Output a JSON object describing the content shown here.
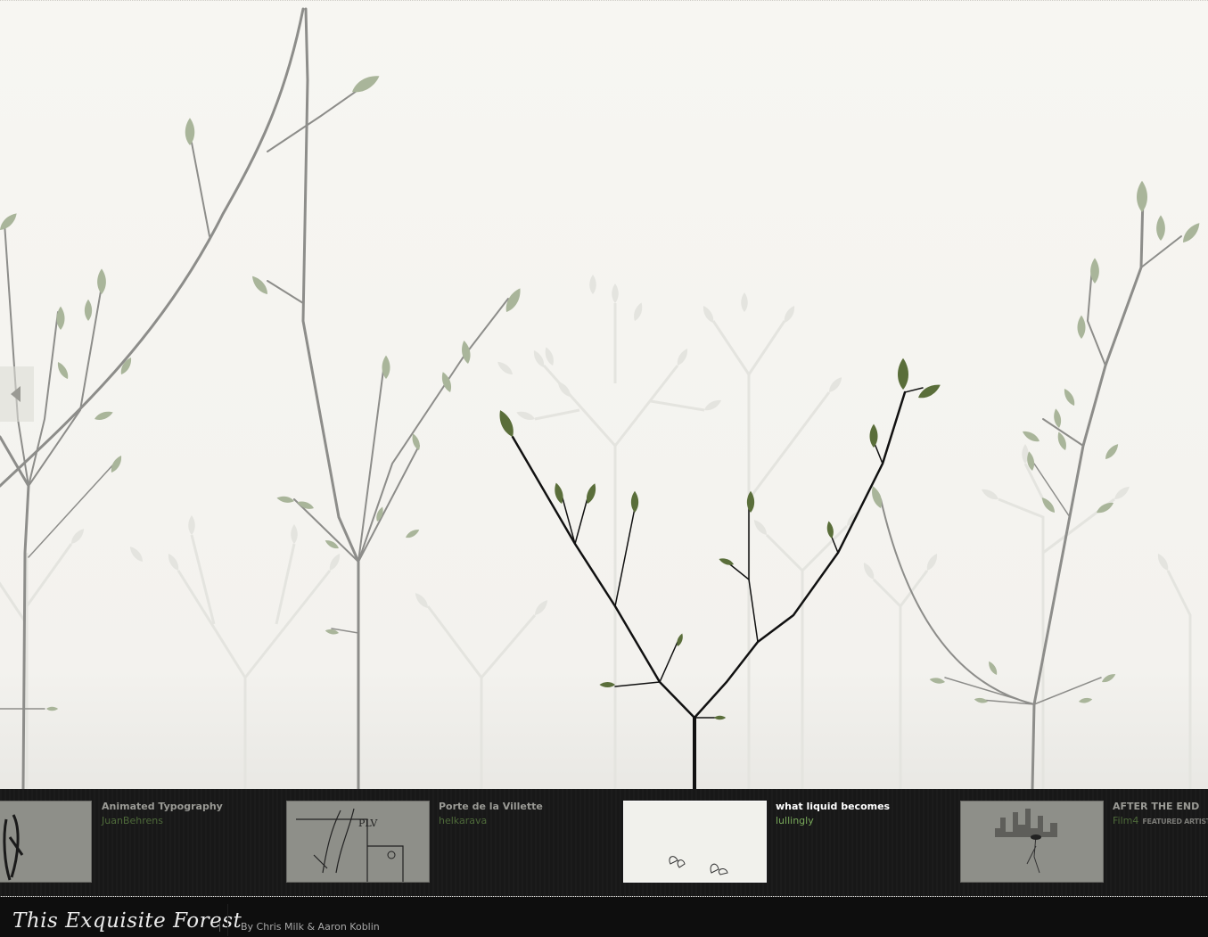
{
  "app": {
    "logo_text": "This Exquisite Forest",
    "credits": "By Chris Milk & Aaron Koblin"
  },
  "nav": {
    "prev_icon": "triangle-left-icon"
  },
  "shelf": {
    "cards": [
      {
        "title": "Animated Typography",
        "author": "JuanBehrens",
        "badge": "",
        "active": false
      },
      {
        "title": "Porte de la Villette",
        "author": "helkarava",
        "badge": "",
        "active": false
      },
      {
        "title": "what liquid becomes",
        "author": "lullingly",
        "badge": "",
        "active": true
      },
      {
        "title": "AFTER THE END",
        "author": "Film4",
        "badge": "FEATURED ARTIST",
        "active": false
      }
    ]
  },
  "colors": {
    "active_leaf": "#5a6e3a",
    "inactive_leaf": "#a9b59a",
    "background_tree": "#e5e5e0",
    "shelf": "#181818",
    "footer": "#0e0e0e"
  }
}
